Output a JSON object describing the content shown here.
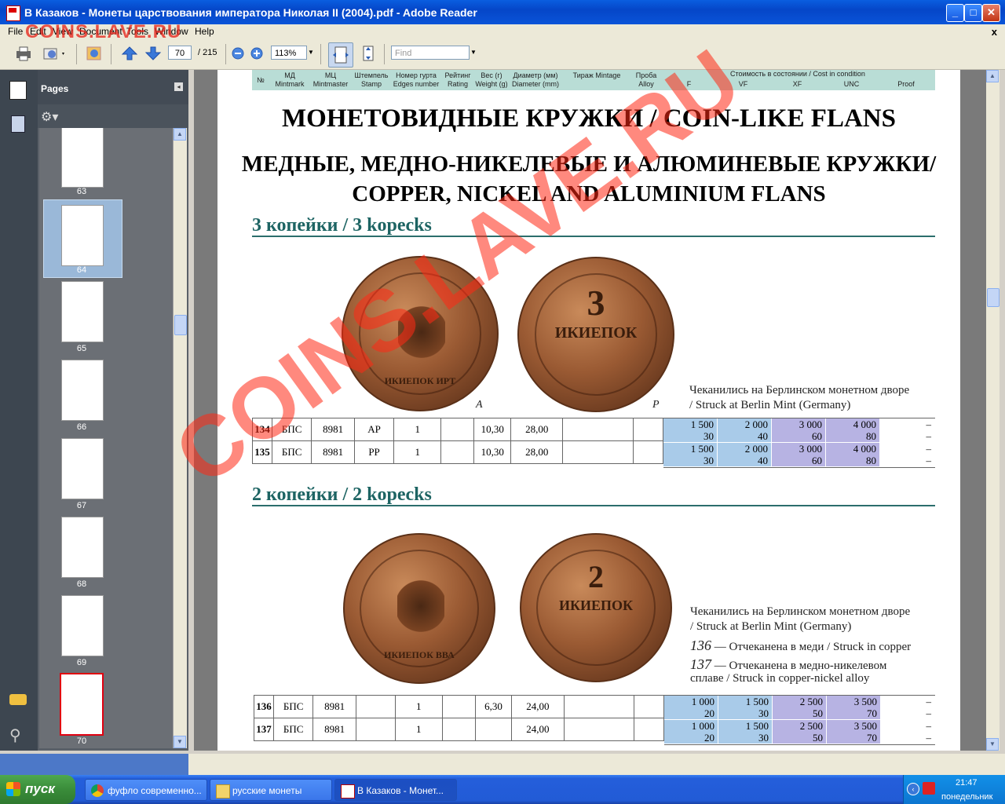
{
  "window": {
    "title": "В Казаков - Монеты царствования императора Николая II (2004).pdf - Adobe Reader",
    "btn_min": "_",
    "btn_max": "□",
    "btn_close": "✕"
  },
  "menu": [
    "File",
    "Edit",
    "View",
    "Document",
    "Tools",
    "Window",
    "Help"
  ],
  "menu_close": "x",
  "overlay_watermark_top": "COINS.LAVE.RU",
  "toolbar": {
    "page_current": "70",
    "page_total": "/ 215",
    "zoom": "113%",
    "find_placeholder": "Find"
  },
  "pages_panel": {
    "title": "Pages",
    "thumbnail_labels": [
      "63",
      "64",
      "65",
      "66",
      "67",
      "68",
      "69",
      "70"
    ],
    "selected": "70"
  },
  "document": {
    "table_header": {
      "no": "№",
      "md": "МД Mintmark",
      "mc": "МЦ Mintmaster",
      "stamp": "Штемпель Stamp",
      "edge": "Номер гурта Edges number",
      "rating": "Рейтинг Rating",
      "weight": "Вес (г) Weight (g)",
      "diameter": "Диаметр (мм) Diameter (mm)",
      "mintage": "Тираж Mintage",
      "alloy": "Проба Alloy",
      "cost": "Стоимость в состоянии / Cost in condition",
      "grades": [
        "F",
        "VF",
        "XF",
        "UNC",
        "Proof"
      ]
    },
    "heading_main": "МОНЕТОВИДНЫЕ КРУЖКИ / COIN-LIKE FLANS",
    "heading_sub_line1": "МЕДНЫЕ, МЕДНО-НИКЕЛЕВЫЕ И АЛЮМИНЕВЫЕ КРУЖКИ/",
    "heading_sub_line2": "COPPER, NICKEL AND ALUMINIUM FLANS",
    "section1": {
      "title": "3 копейки / 3 kopecks",
      "coin_obv_text": "ИКИЕПОК ИРТ",
      "coin_rev_text": "3",
      "coin_rev_text2": "ИКИЕПОК",
      "label_a": "A",
      "label_p": "P",
      "note_line1": "Чеканились на Берлинском монетном дворе",
      "note_line2": "/ Struck at Berlin Mint (Germany)",
      "rows": [
        {
          "no": "134",
          "md": "БПС",
          "stamp": "8981",
          "edge": "АР",
          "rating": "1",
          "weight": "10,30",
          "diameter": "28,00",
          "prices_top": [
            "1 500",
            "2 000",
            "3 000",
            "4 000",
            "–"
          ],
          "prices_bottom": [
            "30",
            "40",
            "60",
            "80",
            "–"
          ]
        },
        {
          "no": "135",
          "md": "БПС",
          "stamp": "8981",
          "edge": "РР",
          "rating": "1",
          "weight": "10,30",
          "diameter": "28,00",
          "prices_top": [
            "1 500",
            "2 000",
            "3 000",
            "4 000",
            "–"
          ],
          "prices_bottom": [
            "30",
            "40",
            "60",
            "80",
            "–"
          ]
        }
      ]
    },
    "section2": {
      "title": "2 копейки / 2 kopecks",
      "coin_obv_text": "ИКИЕПОК ВВА",
      "coin_rev_text": "2",
      "coin_rev_text2": "ИКИЕПОК",
      "note_line1": "Чеканились на Берлинском монетном дворе",
      "note_line2": "/ Struck at Berlin Mint (Germany)",
      "note_136_num": "136",
      "note_136": " — Отчеканена в меди / Struck in copper",
      "note_137_num": "137",
      "note_137_a": " — Отчеканена в медно-никелевом",
      "note_137_b": "сплаве / Struck in copper-nickel alloy",
      "rows": [
        {
          "no": "136",
          "md": "БПС",
          "stamp": "8981",
          "rating": "1",
          "weight": "6,30",
          "diameter": "24,00",
          "prices_top": [
            "1 000",
            "1 500",
            "2 500",
            "3 500",
            "–"
          ],
          "prices_bottom": [
            "20",
            "30",
            "50",
            "70",
            "–"
          ]
        },
        {
          "no": "137",
          "md": "БПС",
          "stamp": "8981",
          "rating": "1",
          "weight": "",
          "diameter": "24,00",
          "prices_top": [
            "1 000",
            "1 500",
            "2 500",
            "3 500",
            "–"
          ],
          "prices_bottom": [
            "20",
            "30",
            "50",
            "70",
            "–"
          ]
        }
      ]
    },
    "watermark": "COINS.LAVE.RU"
  },
  "taskbar": {
    "start": "пуск",
    "tasks": [
      "фуфло современно...",
      "русские монеты",
      "В Казаков - Монет..."
    ],
    "clock": "21:47",
    "day": "понедельник"
  },
  "colors": {
    "price_blue": "#a9cbe9",
    "price_purple": "#b7b3e3",
    "section_teal": "#1d6463"
  }
}
